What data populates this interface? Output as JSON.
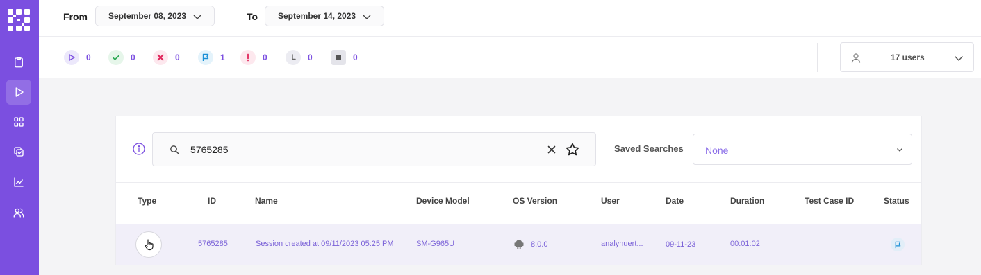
{
  "colors": {
    "brand": "#7b4fe0",
    "accent_text": "#7b62d8"
  },
  "sidebar": {
    "logo": "grid-logo-icon",
    "items": [
      {
        "icon": "clipboard-icon",
        "active": false
      },
      {
        "icon": "play-icon",
        "active": true
      },
      {
        "icon": "apps-grid-icon",
        "active": false
      },
      {
        "icon": "copy-check-icon",
        "active": false
      },
      {
        "icon": "line-chart-icon",
        "active": false
      },
      {
        "icon": "users-icon",
        "active": false
      }
    ]
  },
  "header": {
    "from_label": "From",
    "from_date": "September 08, 2023",
    "to_label": "To",
    "to_date": "September 14, 2023"
  },
  "stats": [
    {
      "icon": "play-icon",
      "count": "0"
    },
    {
      "icon": "check-icon",
      "count": "0"
    },
    {
      "icon": "x-icon",
      "count": "0"
    },
    {
      "icon": "flag-icon",
      "count": "1"
    },
    {
      "icon": "exclamation-icon",
      "count": "0"
    },
    {
      "icon": "clock-icon",
      "count": "0"
    },
    {
      "icon": "stop-icon",
      "count": "0"
    }
  ],
  "users_filter": {
    "label": "17 users"
  },
  "search": {
    "value": "5765285",
    "placeholder": ""
  },
  "saved_searches": {
    "label": "Saved Searches",
    "selected": "None"
  },
  "table": {
    "columns": [
      "Type",
      "ID",
      "Name",
      "Device Model",
      "OS Version",
      "User",
      "Date",
      "Duration",
      "Test Case ID",
      "Status"
    ],
    "rows": [
      {
        "type_icon": "hand-pointer-icon",
        "id": "5765285",
        "name": "Session created at 09/11/2023 05:25 PM",
        "device_model": "SM-G965U",
        "os_icon": "android-icon",
        "os_version": "8.0.0",
        "user": "analyhuert...",
        "date": "09-11-23",
        "duration": "00:01:02",
        "test_case_id": "",
        "status_icon": "flag-icon"
      }
    ]
  }
}
